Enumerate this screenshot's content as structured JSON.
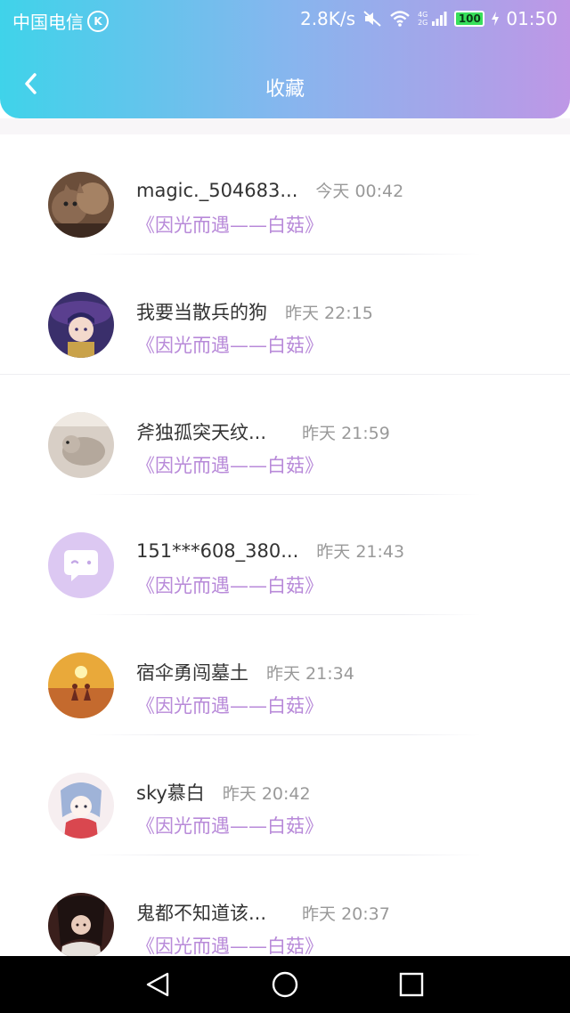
{
  "status_bar": {
    "carrier": "中国电信",
    "carrier_badge": "K",
    "speed": "2.8K/s",
    "network": "4G",
    "network_sub": "2G",
    "battery": "100",
    "time": "01:50"
  },
  "header": {
    "title": "收藏",
    "back_icon": "chevron-left-icon"
  },
  "colors": {
    "gradient_start": "#3fd3ea",
    "gradient_end": "#be97e6",
    "subtitle": "#b88ad9",
    "name": "#333333",
    "time": "#999999"
  },
  "list": {
    "items": [
      {
        "name": "magic._504683...",
        "time": "今天 00:42",
        "subtitle": "《因光而遇——白菇》",
        "avatar": "cat-photo"
      },
      {
        "name": "我要当散兵的狗",
        "time": "昨天 22:15",
        "subtitle": "《因光而遇——白菇》",
        "avatar": "anime-character"
      },
      {
        "name": "斧独孤突天纹...",
        "time": "昨天 21:59",
        "subtitle": "《因光而遇——白菇》",
        "avatar": "small-animal"
      },
      {
        "name": "151***608_380...",
        "time": "昨天 21:43",
        "subtitle": "《因光而遇——白菇》",
        "avatar": "default-chat-avatar"
      },
      {
        "name": "宿伞勇闯墓土",
        "time": "昨天 21:34",
        "subtitle": "《因光而遇——白菇》",
        "avatar": "sunset-figures"
      },
      {
        "name": "sky慕白",
        "time": "昨天 20:42",
        "subtitle": "《因光而遇——白菇》",
        "avatar": "anime-sketch"
      },
      {
        "name": "鬼都不知道该...",
        "time": "昨天 20:37",
        "subtitle": "《因光而遇——白菇》",
        "avatar": "dark-character"
      }
    ]
  },
  "nav_bar": {
    "back": "triangle-back-icon",
    "home": "circle-home-icon",
    "recents": "square-recents-icon"
  }
}
